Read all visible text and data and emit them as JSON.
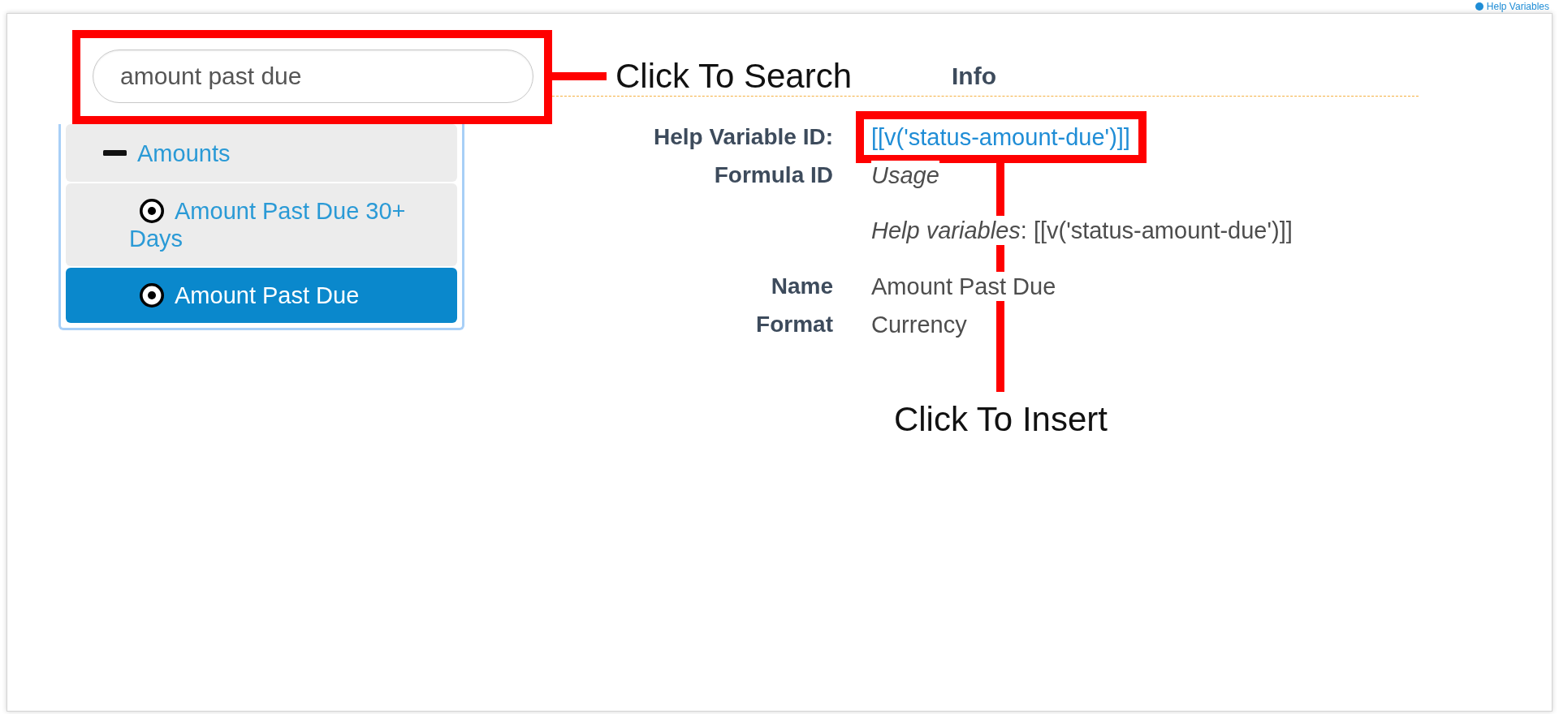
{
  "top_link": {
    "label": "Help Variables"
  },
  "search": {
    "value": "amount past due"
  },
  "search_callout": {
    "label": "Click To Search"
  },
  "tree": {
    "items": [
      {
        "label": "Amounts",
        "selected": false,
        "expanded": true,
        "children": [
          {
            "label": "Amount Past Due 30+ Days",
            "selected": false
          },
          {
            "label": "Amount Past Due",
            "selected": true
          }
        ]
      }
    ]
  },
  "info": {
    "title": "Info",
    "fields": [
      {
        "kind": "link",
        "label": "Help Variable ID:",
        "value": "[[v('status-amount-due')]]"
      },
      {
        "kind": "formula",
        "label": "Formula ID",
        "value": "Usage",
        "note": "*Help variables*: [[v('status-amount-due')]]"
      },
      {
        "kind": "text",
        "label": "Name",
        "value": "Amount Past Due"
      },
      {
        "kind": "text",
        "label": "Format",
        "value": "Currency"
      }
    ]
  },
  "insert_callout": {
    "label": "Click To Insert"
  }
}
